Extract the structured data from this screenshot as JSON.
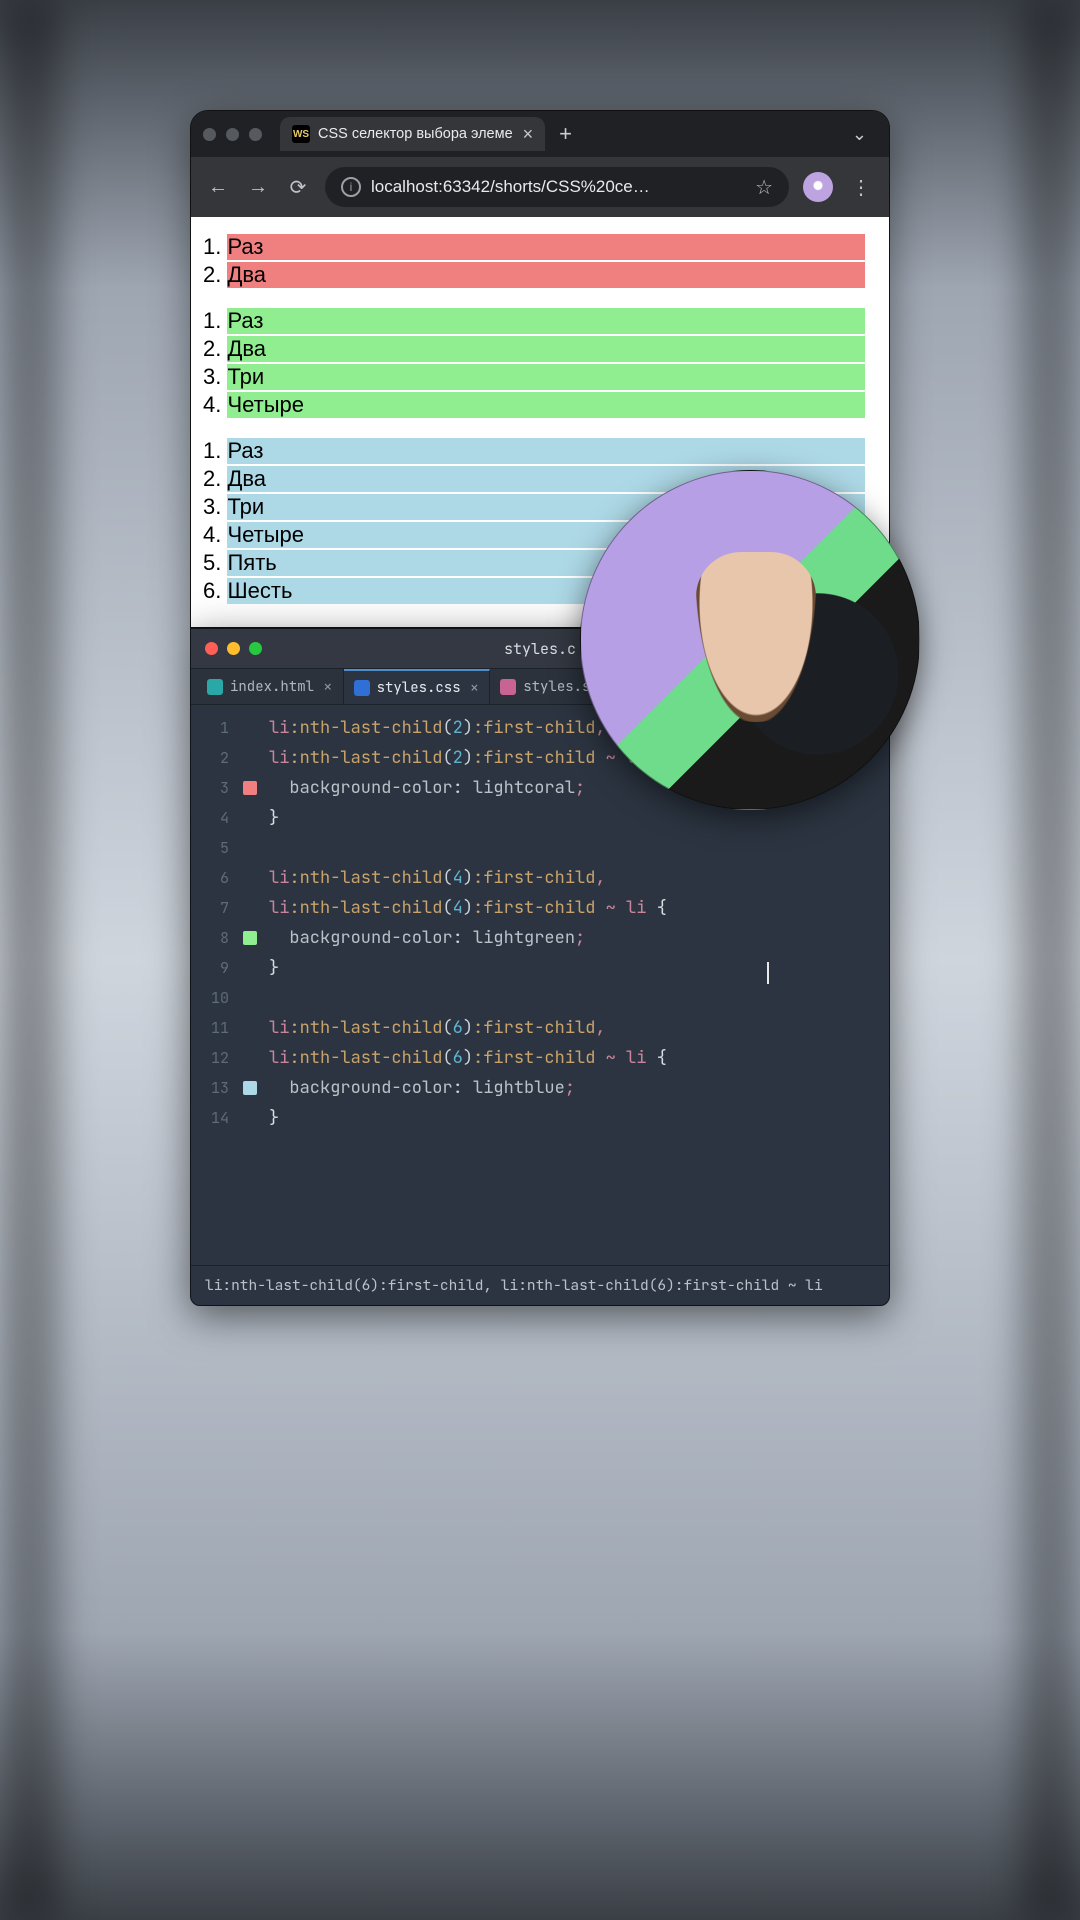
{
  "browser": {
    "tab": {
      "favicon_text": "WS",
      "title": "CSS селектор выбора элеме"
    },
    "url": "localhost:63342/shorts/CSS%20се…",
    "lists": [
      {
        "className": "list-2",
        "items": [
          "Раз",
          "Два"
        ]
      },
      {
        "className": "list-4",
        "items": [
          "Раз",
          "Два",
          "Три",
          "Четыре"
        ]
      },
      {
        "className": "list-6",
        "items": [
          "Раз",
          "Два",
          "Три",
          "Четыре",
          "Пять",
          "Шесть"
        ]
      }
    ]
  },
  "editor": {
    "window_title": "styles.c",
    "tabs": [
      {
        "icon": "html",
        "label": "index.html",
        "active": false
      },
      {
        "icon": "css",
        "label": "styles.css",
        "active": true
      },
      {
        "icon": "scss",
        "label": "styles.scss",
        "active": false
      }
    ],
    "swatches": [
      {
        "line": 3,
        "color": "#f08080"
      },
      {
        "line": 8,
        "color": "#90ee90"
      },
      {
        "line": 13,
        "color": "#add8e6"
      }
    ],
    "code_lines": [
      {
        "n": 1,
        "html": "<span class='tk-tag'>li</span><span class='tk-psel'>:nth-last-child</span>(<span class='tk-num'>2</span>)<span class='tk-psel'>:first-child</span><span class='tk-punc'>,</span>"
      },
      {
        "n": 2,
        "html": "<span class='tk-tag'>li</span><span class='tk-psel'>:nth-last-child</span>(<span class='tk-num'>2</span>)<span class='tk-psel'>:first-child</span> <span class='tk-punc'>~</span> <span class='tk-tag'>li</span> <span class='tk-brace'>{</span>"
      },
      {
        "n": 3,
        "html": "  <span class='tk-prop'>background-color</span>: <span class='tk-val'>lightcoral</span><span class='tk-punc'>;</span>"
      },
      {
        "n": 4,
        "html": "<span class='tk-brace'>}</span>"
      },
      {
        "n": 5,
        "html": ""
      },
      {
        "n": 6,
        "html": "<span class='tk-tag'>li</span><span class='tk-psel'>:nth-last-child</span>(<span class='tk-num'>4</span>)<span class='tk-psel'>:first-child</span><span class='tk-punc'>,</span>"
      },
      {
        "n": 7,
        "html": "<span class='tk-tag'>li</span><span class='tk-psel'>:nth-last-child</span>(<span class='tk-num'>4</span>)<span class='tk-psel'>:first-child</span> <span class='tk-punc'>~</span> <span class='tk-tag'>li</span> <span class='tk-brace'>{</span>"
      },
      {
        "n": 8,
        "html": "  <span class='tk-prop'>background-color</span>: <span class='tk-val'>lightgreen</span><span class='tk-punc'>;</span>"
      },
      {
        "n": 9,
        "html": "<span class='tk-brace'>}</span>"
      },
      {
        "n": 10,
        "html": ""
      },
      {
        "n": 11,
        "html": "<span class='tk-tag'>li</span><span class='tk-psel'>:nth-last-child</span>(<span class='tk-num'>6</span>)<span class='tk-psel'>:first-child</span><span class='tk-punc'>,</span>"
      },
      {
        "n": 12,
        "html": "<span class='tk-tag'>li</span><span class='tk-psel'>:nth-last-child</span>(<span class='tk-num'>6</span>)<span class='tk-psel'>:first-child</span> <span class='tk-punc'>~</span> <span class='tk-tag'>li</span> <span class='tk-brace'>{</span>"
      },
      {
        "n": 13,
        "html": "  <span class='tk-prop'>background-color</span>: <span class='tk-val'>lightblue</span><span class='tk-punc'>;</span>"
      },
      {
        "n": 14,
        "html": "<span class='tk-brace'>}</span>"
      }
    ],
    "breadcrumb": "li:nth-last-child(6):first-child, li:nth-last-child(6):first-child ~ li"
  }
}
